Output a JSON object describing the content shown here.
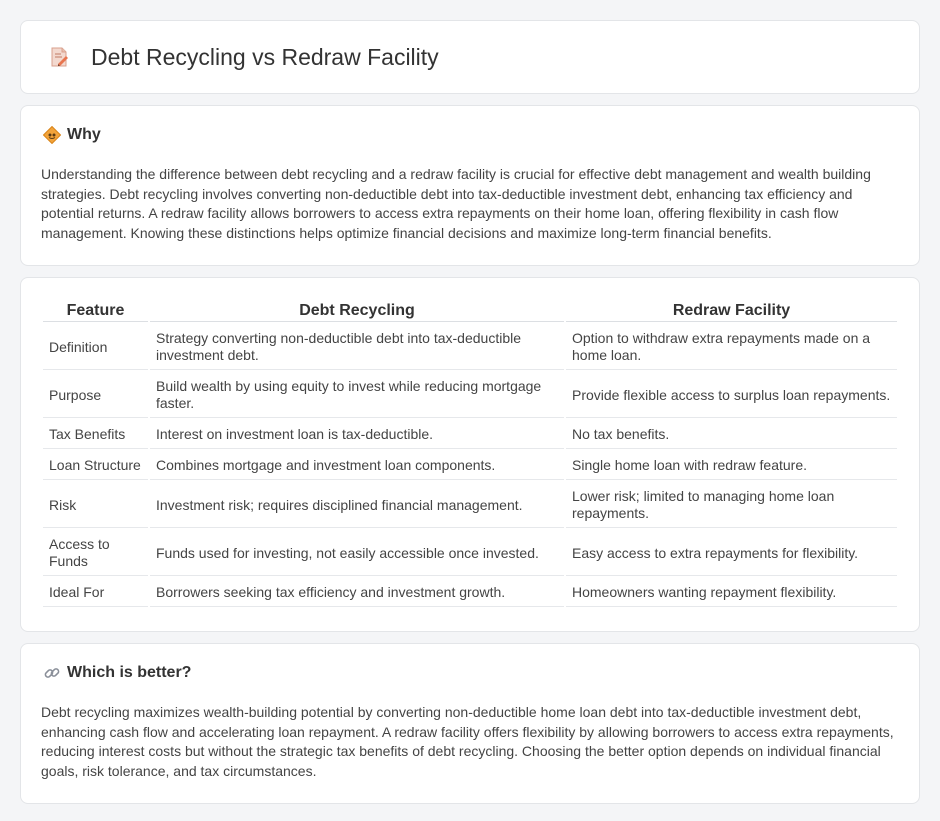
{
  "page": {
    "title": "Debt Recycling vs Redraw Facility",
    "icon": "document-pen-icon"
  },
  "why": {
    "icon": "diamond-sign-icon",
    "title": "Why",
    "text": "Understanding the difference between debt recycling and a redraw facility is crucial for effective debt management and wealth building strategies. Debt recycling involves converting non-deductible debt into tax-deductible investment debt, enhancing tax efficiency and potential returns. A redraw facility allows borrowers to access extra repayments on their home loan, offering flexibility in cash flow management. Knowing these distinctions helps optimize financial decisions and maximize long-term financial benefits."
  },
  "table": {
    "headers": [
      "Feature",
      "Debt Recycling",
      "Redraw Facility"
    ],
    "rows": [
      [
        "Definition",
        "Strategy converting non-deductible debt into tax-deductible investment debt.",
        "Option to withdraw extra repayments made on a home loan."
      ],
      [
        "Purpose",
        "Build wealth by using equity to invest while reducing mortgage faster.",
        "Provide flexible access to surplus loan repayments."
      ],
      [
        "Tax Benefits",
        "Interest on investment loan is tax-deductible.",
        "No tax benefits."
      ],
      [
        "Loan Structure",
        "Combines mortgage and investment loan components.",
        "Single home loan with redraw feature."
      ],
      [
        "Risk",
        "Investment risk; requires disciplined financial management.",
        "Lower risk; limited to managing home loan repayments."
      ],
      [
        "Access to Funds",
        "Funds used for investing, not easily accessible once invested.",
        "Easy access to extra repayments for flexibility."
      ],
      [
        "Ideal For",
        "Borrowers seeking tax efficiency and investment growth.",
        "Homeowners wanting repayment flexibility."
      ]
    ]
  },
  "which": {
    "icon": "link-icon",
    "title": "Which is better?",
    "text": "Debt recycling maximizes wealth-building potential by converting non-deductible home loan debt into tax-deductible investment debt, enhancing cash flow and accelerating loan repayment. A redraw facility offers flexibility by allowing borrowers to access extra repayments, reducing interest costs but without the strategic tax benefits of debt recycling. Choosing the better option depends on individual financial goals, risk tolerance, and tax circumstances."
  }
}
